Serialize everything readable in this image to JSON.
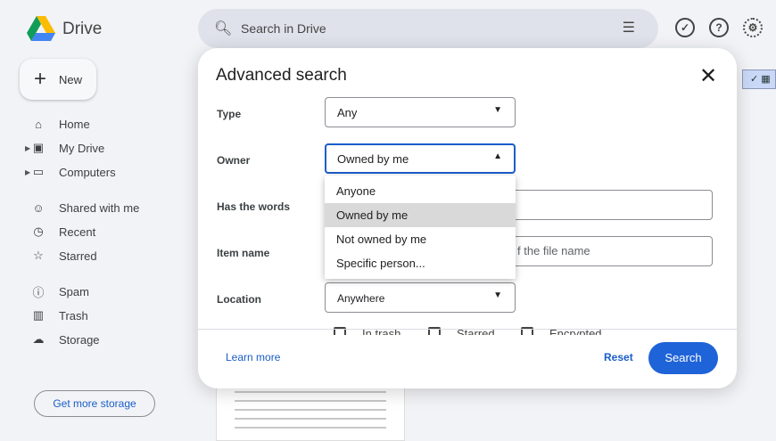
{
  "app": {
    "brand": "Drive",
    "search_placeholder": "Search in Drive"
  },
  "sidebar": {
    "new_label": "New",
    "items": [
      {
        "label": "Home",
        "icon": "home-icon"
      },
      {
        "label": "My Drive",
        "icon": "my-drive-icon"
      },
      {
        "label": "Computers",
        "icon": "computers-icon"
      },
      {
        "label": "Shared with me",
        "icon": "shared-icon"
      },
      {
        "label": "Recent",
        "icon": "clock-icon"
      },
      {
        "label": "Starred",
        "icon": "star-icon"
      },
      {
        "label": "Spam",
        "icon": "spam-icon"
      },
      {
        "label": "Trash",
        "icon": "trash-icon"
      },
      {
        "label": "Storage",
        "icon": "cloud-icon"
      }
    ],
    "storage_button": "Get more storage"
  },
  "dialog": {
    "title": "Advanced search",
    "fields": {
      "type": {
        "label": "Type",
        "value": "Any"
      },
      "owner": {
        "label": "Owner",
        "value": "Owned by me"
      },
      "has_words": {
        "label": "Has the words"
      },
      "item_name": {
        "label": "Item name",
        "placeholder_tail": "f the file name"
      },
      "location": {
        "label": "Location",
        "value": "Anywhere"
      }
    },
    "owner_options": [
      "Anyone",
      "Owned by me",
      "Not owned by me",
      "Specific person..."
    ],
    "owner_selected": "Owned by me",
    "checkboxes": [
      "In trash",
      "Starred",
      "Encrypted"
    ],
    "learn_more": "Learn more",
    "reset": "Reset",
    "search": "Search"
  },
  "colors": {
    "accent": "#1f63d8",
    "link": "#1a5dc9",
    "dropdown_selected": "#d9d9d9"
  }
}
